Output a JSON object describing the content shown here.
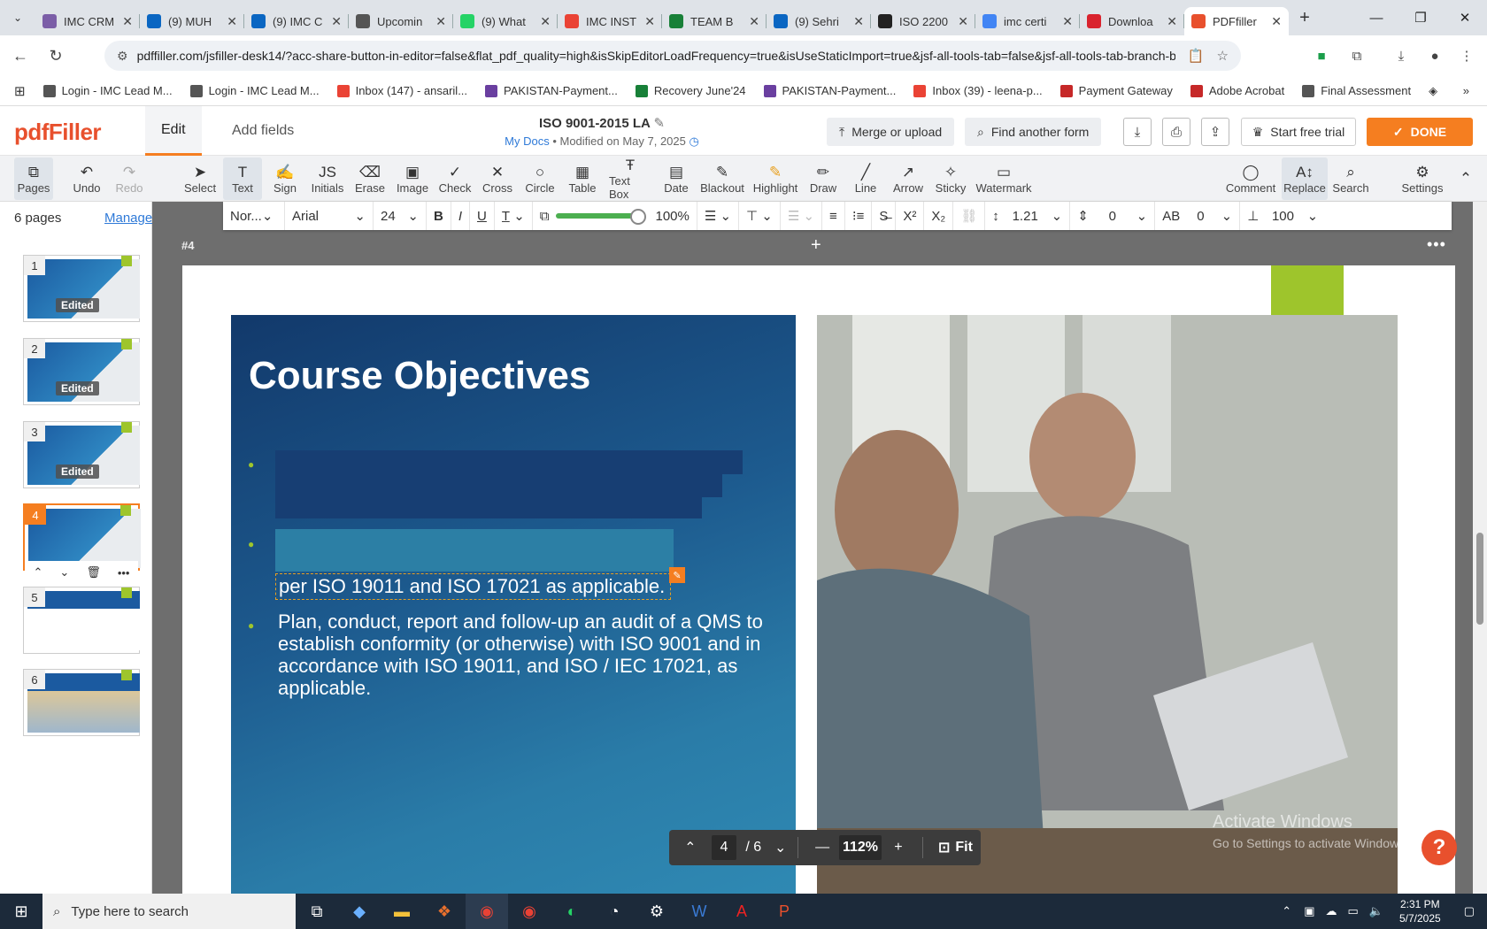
{
  "browser": {
    "tabs": [
      {
        "label": "IMC CRM",
        "icon": "imc-icon",
        "color": "#7b5ea7"
      },
      {
        "label": "(9) MUH",
        "icon": "linkedin-icon",
        "color": "#0a66c2"
      },
      {
        "label": "(9) IMC C",
        "icon": "linkedin-icon",
        "color": "#0a66c2"
      },
      {
        "label": "Upcomin",
        "icon": "imc-icon",
        "color": "#555"
      },
      {
        "label": "(9) What",
        "icon": "whatsapp-icon",
        "color": "#25d366"
      },
      {
        "label": "IMC INST",
        "icon": "gmail-icon",
        "color": "#ea4335"
      },
      {
        "label": "TEAM B",
        "icon": "sheets-icon",
        "color": "#188038"
      },
      {
        "label": "(9) Sehri",
        "icon": "linkedin-icon",
        "color": "#0a66c2"
      },
      {
        "label": "ISO 2200",
        "icon": "chatgpt-icon",
        "color": "#222"
      },
      {
        "label": "imc certi",
        "icon": "google-icon",
        "color": "#4285f4"
      },
      {
        "label": "Downloa",
        "icon": "heart-icon",
        "color": "#d9232e"
      },
      {
        "label": "PDFfiller",
        "icon": "pdffiller-icon",
        "color": "#e8502d"
      }
    ],
    "url": "pdffiller.com/jsfiller-desk14/?acc-share-button-in-editor=false&flat_pdf_quality=high&isSkipEditorLoadFrequency=true&isUseStaticImport=true&jsf-all-tools-tab=false&jsf-all-tools-tab-branch-b=fa...",
    "bookmarks": [
      {
        "label": "Login - IMC Lead M...",
        "color": "#555"
      },
      {
        "label": "Login - IMC Lead M...",
        "color": "#555"
      },
      {
        "label": "Inbox (147) - ansaril...",
        "color": "#ea4335"
      },
      {
        "label": "PAKISTAN-Payment...",
        "color": "#6a3fa0"
      },
      {
        "label": "Recovery June'24",
        "color": "#188038"
      },
      {
        "label": "PAKISTAN-Payment...",
        "color": "#6a3fa0"
      },
      {
        "label": "Inbox (39) - leena-p...",
        "color": "#ea4335"
      },
      {
        "label": "Payment Gateway",
        "color": "#c62828"
      },
      {
        "label": "Adobe Acrobat",
        "color": "#c62828"
      },
      {
        "label": "Final Assessment",
        "color": "#555"
      }
    ]
  },
  "app": {
    "logo": "pdfFiller",
    "tabs": {
      "edit": "Edit",
      "add_fields": "Add fields"
    },
    "doc_title": "ISO 9001-2015 LA",
    "my_docs": "My Docs",
    "modified": "Modified on May 7, 2025",
    "merge": "Merge or upload",
    "find_form": "Find another form",
    "trial": "Start free trial",
    "done": "DONE"
  },
  "tools": {
    "pages": "Pages",
    "undo": "Undo",
    "redo": "Redo",
    "select": "Select",
    "text": "Text",
    "sign": "Sign",
    "initials": "Initials",
    "erase": "Erase",
    "image": "Image",
    "check": "Check",
    "cross": "Cross",
    "circle": "Circle",
    "table": "Table",
    "textbox": "Text Box",
    "date": "Date",
    "blackout": "Blackout",
    "highlight": "Highlight",
    "draw": "Draw",
    "line": "Line",
    "arrow": "Arrow",
    "sticky": "Sticky",
    "watermark": "Watermark",
    "comment": "Comment",
    "replace": "Replace",
    "search": "Search",
    "settings": "Settings"
  },
  "format": {
    "style": "Nor...",
    "font": "Arial",
    "size": "24",
    "opacity": "100%",
    "line_height": "1.21",
    "spacing": "0",
    "char_spacing": "0",
    "scale": "100"
  },
  "sidebar": {
    "count": "6 pages",
    "manage": "Manage",
    "pages": [
      {
        "num": "1",
        "badge": "Edited"
      },
      {
        "num": "2",
        "badge": "Edited"
      },
      {
        "num": "3",
        "badge": "Edited"
      },
      {
        "num": "4",
        "badge": ""
      },
      {
        "num": "5",
        "badge": ""
      },
      {
        "num": "6",
        "badge": ""
      }
    ]
  },
  "canvas": {
    "page_label": "#4",
    "slide_title": "Course Objectives",
    "edited_line": "per ISO 19011 and ISO 17021 as applicable.",
    "body": "Plan, conduct, report and follow-up an audit of a QMS to establish conformity (or otherwise) with ISO 9001 and in accordance with ISO 19011, and ISO / IEC 17021, as applicable."
  },
  "pager": {
    "current": "4",
    "total": "/ 6",
    "zoom": "112%",
    "fit": "Fit"
  },
  "windows": {
    "activate_title": "Activate Windows",
    "activate_sub": "Go to Settings to activate Windows.",
    "search_placeholder": "Type here to search",
    "time": "2:31 PM",
    "date": "5/7/2025"
  }
}
